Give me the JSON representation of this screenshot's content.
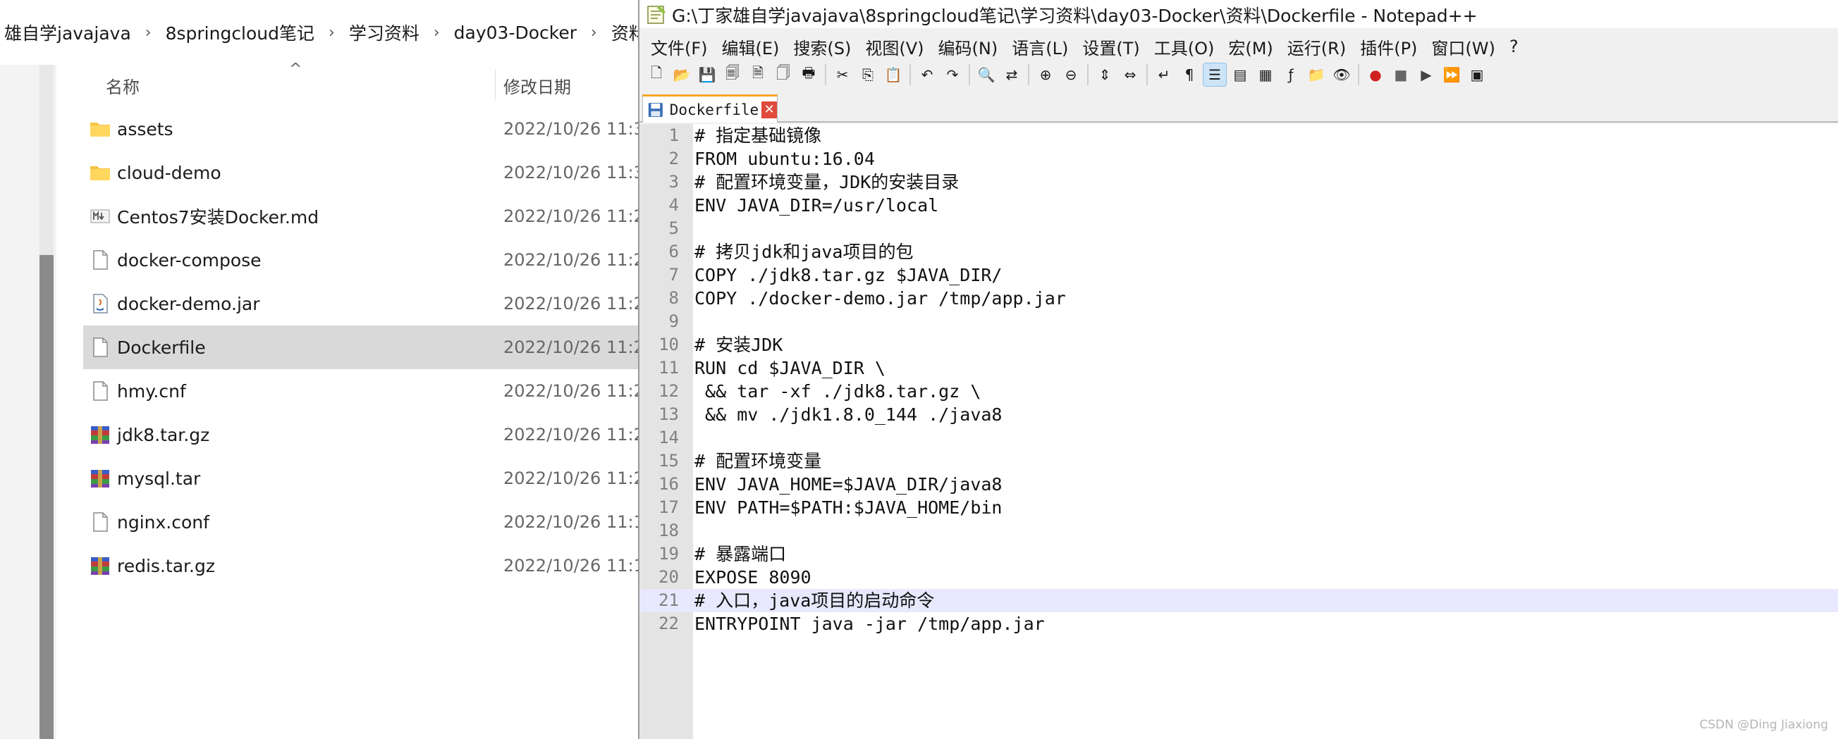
{
  "explorer": {
    "breadcrumb": [
      "雄自学javajava",
      "8springcloud笔记",
      "学习资料",
      "day03-Docker",
      "资料"
    ],
    "columns": {
      "name": "名称",
      "modified": "修改日期"
    },
    "files": [
      {
        "name": "assets",
        "date": "2022/10/26 11:3",
        "icon": "folder-icon"
      },
      {
        "name": "cloud-demo",
        "date": "2022/10/26 11:3",
        "icon": "folder-icon"
      },
      {
        "name": "Centos7安装Docker.md",
        "date": "2022/10/26 11:2",
        "icon": "markdown-file-icon"
      },
      {
        "name": "docker-compose",
        "date": "2022/10/26 11:2",
        "icon": "file-icon"
      },
      {
        "name": "docker-demo.jar",
        "date": "2022/10/26 11:2",
        "icon": "jar-file-icon"
      },
      {
        "name": "Dockerfile",
        "date": "2022/10/26 11:2",
        "icon": "file-icon",
        "selected": true
      },
      {
        "name": "hmy.cnf",
        "date": "2022/10/26 11:2",
        "icon": "file-icon"
      },
      {
        "name": "jdk8.tar.gz",
        "date": "2022/10/26 11:2",
        "icon": "archive-icon"
      },
      {
        "name": "mysql.tar",
        "date": "2022/10/26 11:2",
        "icon": "archive-icon"
      },
      {
        "name": "nginx.conf",
        "date": "2022/10/26 11:1",
        "icon": "file-icon"
      },
      {
        "name": "redis.tar.gz",
        "date": "2022/10/26 11:1",
        "icon": "archive-icon"
      }
    ]
  },
  "notepad": {
    "title": "G:\\丁家雄自学javajava\\8springcloud笔记\\学习资料\\day03-Docker\\资料\\Dockerfile - Notepad++",
    "menu": [
      "文件(F)",
      "编辑(E)",
      "搜索(S)",
      "视图(V)",
      "编码(N)",
      "语言(L)",
      "设置(T)",
      "工具(O)",
      "宏(M)",
      "运行(R)",
      "插件(P)",
      "窗口(W)",
      "?"
    ],
    "tab_label": "Dockerfile",
    "current_line": 21,
    "lines": [
      "# 指定基础镜像",
      "FROM ubuntu:16.04",
      "# 配置环境变量，JDK的安装目录",
      "ENV JAVA_DIR=/usr/local",
      "",
      "# 拷贝jdk和java项目的包",
      "COPY ./jdk8.tar.gz $JAVA_DIR/",
      "COPY ./docker-demo.jar /tmp/app.jar",
      "",
      "# 安装JDK",
      "RUN cd $JAVA_DIR \\",
      " && tar -xf ./jdk8.tar.gz \\",
      " && mv ./jdk1.8.0_144 ./java8",
      "",
      "# 配置环境变量",
      "ENV JAVA_HOME=$JAVA_DIR/java8",
      "ENV PATH=$PATH:$JAVA_HOME/bin",
      "",
      "# 暴露端口",
      "EXPOSE 8090",
      "# 入口，java项目的启动命令",
      "ENTRYPOINT java -jar /tmp/app.jar"
    ]
  },
  "watermark": "CSDN @Ding Jiaxiong"
}
